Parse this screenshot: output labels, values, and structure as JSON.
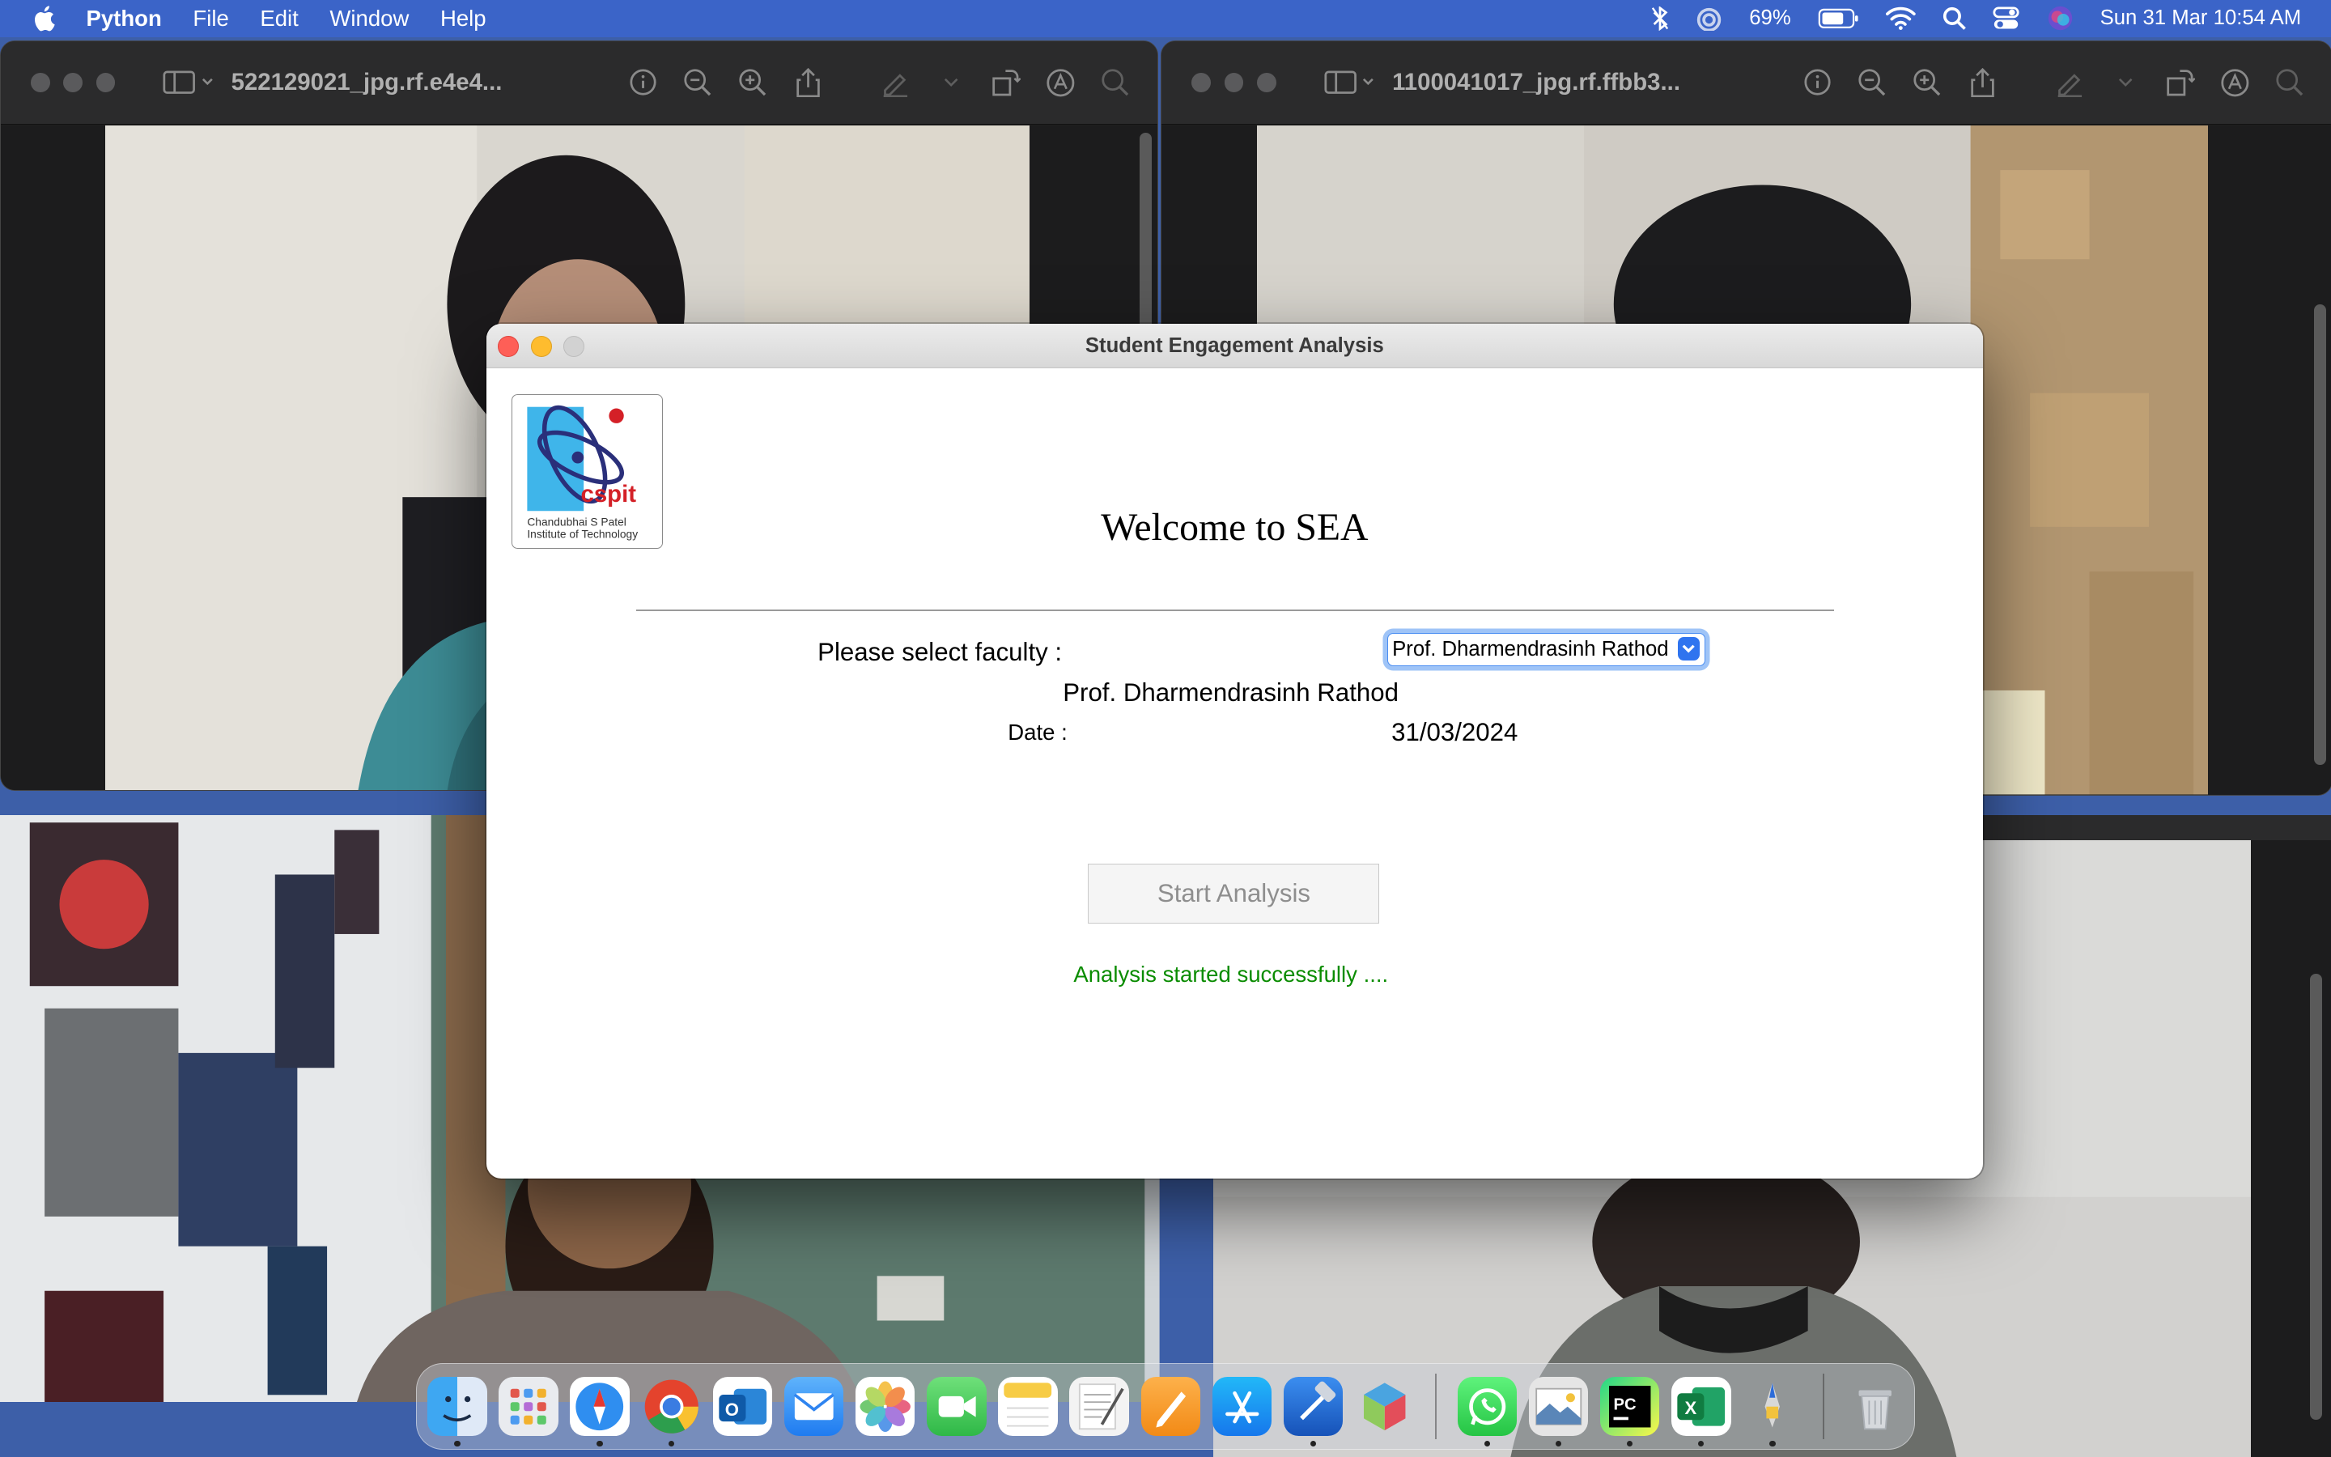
{
  "menubar": {
    "app_name": "Python",
    "menus": [
      "File",
      "Edit",
      "Window",
      "Help"
    ],
    "battery": "69%",
    "datetime": "Sun 31 Mar  10:54 AM"
  },
  "preview_windows": [
    {
      "title": "522129021_jpg.rf.e4e4..."
    },
    {
      "title": "1100041017_jpg.rf.ffbb3..."
    }
  ],
  "dialog": {
    "window_title": "Student Engagement Analysis",
    "logo_text": "cspit",
    "logo_subtitle_1": "Chandubhai S Patel",
    "logo_subtitle_2": "Institute of Technology",
    "welcome": "Welcome to SEA",
    "faculty_label": "Please select faculty :",
    "faculty_selected": "Prof. Dharmendrasinh Rathod",
    "faculty_display": "Prof. Dharmendrasinh Rathod",
    "date_label": "Date :",
    "date_value": "31/03/2024",
    "start_button": "Start Analysis",
    "status_message": "Analysis started successfully ....",
    "status_color": "#0a8c00"
  },
  "dock": {
    "apps": [
      "Finder",
      "Launchpad",
      "Safari",
      "Chrome",
      "Outlook",
      "Mail",
      "Photos",
      "FaceTime",
      "Notes",
      "TextEdit",
      "Pages",
      "App Store",
      "Xcode",
      "Blender",
      "WhatsApp",
      "Preview",
      "PyCharm",
      "Excel",
      "Pen",
      "Trash"
    ]
  }
}
